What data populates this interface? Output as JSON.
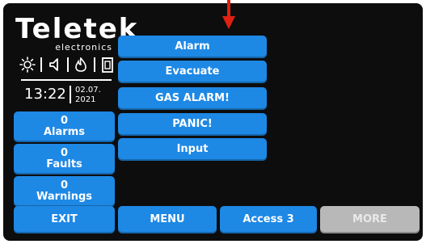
{
  "brand": {
    "name": "Teletek",
    "subtitle": "electronics"
  },
  "status": {
    "icons": [
      "sun-icon",
      "speaker-icon",
      "fire-icon",
      "door-icon"
    ],
    "time": "13:22",
    "date_day_month": "02.07.",
    "date_year": "2021"
  },
  "counters": [
    {
      "value": "0",
      "label": "Alarms"
    },
    {
      "value": "0",
      "label": "Faults"
    },
    {
      "value": "0",
      "label": "Warnings"
    }
  ],
  "actions": [
    "Alarm",
    "Evacuate",
    "GAS ALARM!",
    "PANIC!",
    "Input"
  ],
  "footer": {
    "exit": "EXIT",
    "menu": "MENU",
    "access": "Access 3",
    "more": "MORE"
  },
  "colors": {
    "accent": "#1e88e5",
    "background": "#0d0d0d",
    "disabled": "#b8b8b8",
    "indicator_arrow": "#e02010"
  }
}
